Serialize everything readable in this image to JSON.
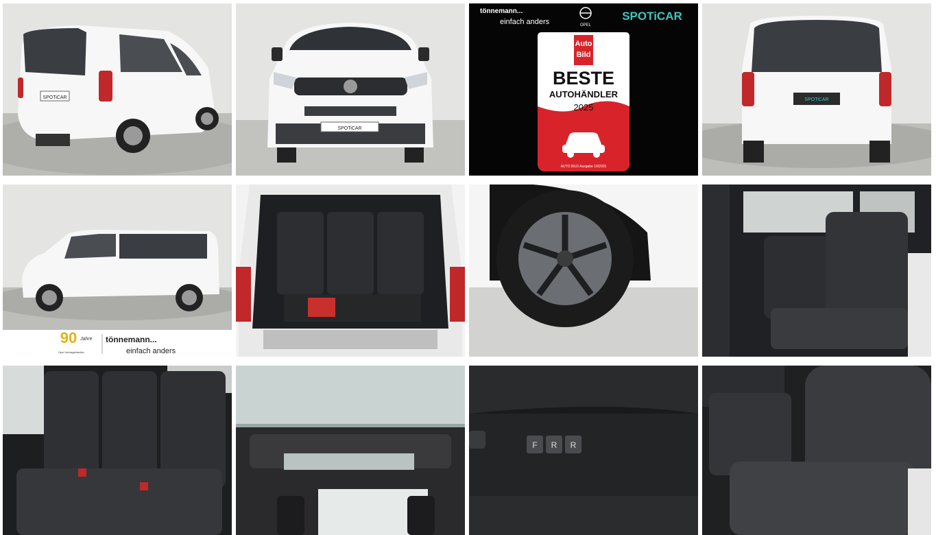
{
  "gallery": {
    "images": [
      {
        "subject": "van-rear-three-quarter"
      },
      {
        "subject": "van-front"
      },
      {
        "subject": "dealer-award-badge"
      },
      {
        "subject": "van-rear"
      },
      {
        "subject": "van-side-profile"
      },
      {
        "subject": "open-trunk"
      },
      {
        "subject": "wheel"
      },
      {
        "subject": "interior-seats"
      },
      {
        "subject": "rear-bench"
      },
      {
        "subject": "panoramic-roof"
      },
      {
        "subject": "seat-controls"
      },
      {
        "subject": "driver-seat"
      }
    ]
  },
  "plate_text": "SPOTiCAR",
  "award": {
    "dealer_name": "tönnemann...",
    "dealer_slogan": "einfach anders",
    "brand": "OPEL",
    "program": "SPOTiCAR",
    "magazine_line1": "Auto",
    "magazine_line2": "Bild",
    "title": "BESTE",
    "subtitle": "AUTOHÄNDLER",
    "year": "2025",
    "footnote": "AUTO BILD Ausgabe 10/2025"
  },
  "dealer_banner": {
    "anniversary_number": "90",
    "anniversary_word": "Jahre",
    "anniversary_caption": "Opel Vertragshändler",
    "name": "tönnemann...",
    "slogan": "einfach anders"
  },
  "seat_buttons": [
    "F",
    "R",
    "R"
  ],
  "colors": {
    "studio_bg": "#e4e4e2",
    "floor": "#bdbdba",
    "van_white": "#f7f7f7",
    "window_dark": "#3a3d42",
    "taillight_red": "#c0282a",
    "award_red": "#d9232a",
    "spoticar_teal": "#3fc6c0",
    "leather_black": "#2a2b2e"
  }
}
